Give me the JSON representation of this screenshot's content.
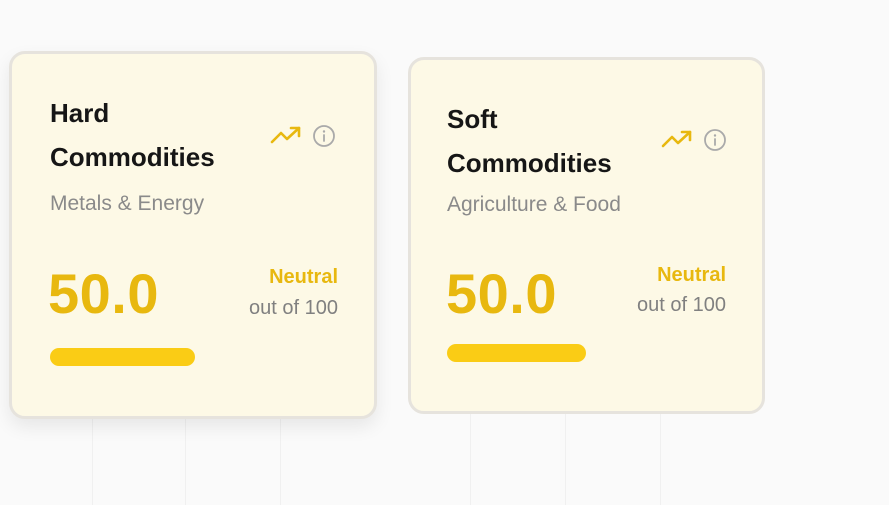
{
  "cards": [
    {
      "title": "Hard Commodities",
      "subtitle": "Metals & Energy",
      "value": "50.0",
      "sentiment": "Neutral",
      "scale": "out of 100",
      "score_fraction": 0.5,
      "icons": [
        "trending-up-icon",
        "info-icon"
      ]
    },
    {
      "title": "Soft Commodities",
      "subtitle": "Agriculture & Food",
      "value": "50.0",
      "sentiment": "Neutral",
      "scale": "out of 100",
      "score_fraction": 0.5,
      "icons": [
        "trending-up-icon",
        "info-icon"
      ]
    }
  ],
  "colors": {
    "accent": "#e8b80f",
    "bar": "#facc15",
    "card_bg": "#fdf9e6",
    "border": "#e6e3dd"
  }
}
